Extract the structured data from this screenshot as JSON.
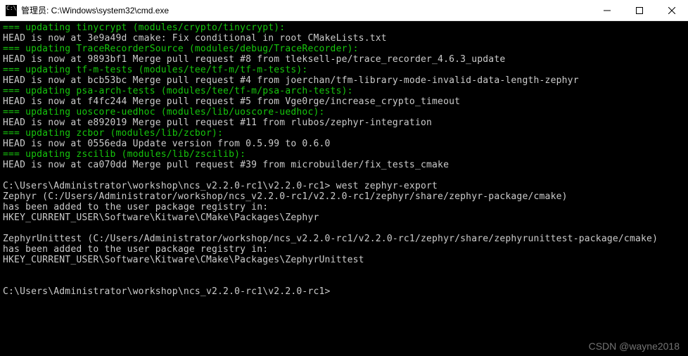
{
  "window": {
    "title": "管理员: C:\\Windows\\system32\\cmd.exe"
  },
  "lines": [
    {
      "spans": [
        {
          "c": "g",
          "t": "=== updating tinycrypt (modules/crypto/tinycrypt):"
        }
      ]
    },
    {
      "spans": [
        {
          "c": "w",
          "t": "HEAD is now at 3e9a49d cmake: Fix conditional in root CMakeLists.txt"
        }
      ]
    },
    {
      "spans": [
        {
          "c": "g",
          "t": "=== updating TraceRecorderSource (modules/debug/TraceRecorder):"
        }
      ]
    },
    {
      "spans": [
        {
          "c": "w",
          "t": "HEAD is now at 9893bf1 Merge pull request #8 from tleksell-pe/trace_recorder_4.6.3_update"
        }
      ]
    },
    {
      "spans": [
        {
          "c": "g",
          "t": "=== updating tf-m-tests (modules/tee/tf-m/tf-m-tests):"
        }
      ]
    },
    {
      "spans": [
        {
          "c": "w",
          "t": "HEAD is now at bcb53bc Merge pull request #4 from joerchan/tfm-library-mode-invalid-data-length-zephyr"
        }
      ]
    },
    {
      "spans": [
        {
          "c": "g",
          "t": "=== updating psa-arch-tests (modules/tee/tf-m/psa-arch-tests):"
        }
      ]
    },
    {
      "spans": [
        {
          "c": "w",
          "t": "HEAD is now at f4fc244 Merge pull request #5 from Vge0rge/increase_crypto_timeout"
        }
      ]
    },
    {
      "spans": [
        {
          "c": "g",
          "t": "=== updating uoscore-uedhoc (modules/lib/uoscore-uedhoc):"
        }
      ]
    },
    {
      "spans": [
        {
          "c": "w",
          "t": "HEAD is now at e892019 Merge pull request #11 from rlubos/zephyr-integration"
        }
      ]
    },
    {
      "spans": [
        {
          "c": "g",
          "t": "=== updating zcbor (modules/lib/zcbor):"
        }
      ]
    },
    {
      "spans": [
        {
          "c": "w",
          "t": "HEAD is now at 0556eda Update version from 0.5.99 to 0.6.0"
        }
      ]
    },
    {
      "spans": [
        {
          "c": "g",
          "t": "=== updating zscilib (modules/lib/zscilib):"
        }
      ]
    },
    {
      "spans": [
        {
          "c": "w",
          "t": "HEAD is now at ca070dd Merge pull request #39 from microbuilder/fix_tests_cmake"
        }
      ]
    },
    {
      "spans": [
        {
          "c": "w",
          "t": ""
        }
      ]
    },
    {
      "spans": [
        {
          "c": "w",
          "t": "C:\\Users\\Administrator\\workshop\\ncs_v2.2.0-rc1\\v2.2.0-rc1> west zephyr-export"
        }
      ]
    },
    {
      "spans": [
        {
          "c": "w",
          "t": "Zephyr (C:/Users/Administrator/workshop/ncs_v2.2.0-rc1/v2.2.0-rc1/zephyr/share/zephyr-package/cmake)"
        }
      ]
    },
    {
      "spans": [
        {
          "c": "w",
          "t": "has been added to the user package registry in:"
        }
      ]
    },
    {
      "spans": [
        {
          "c": "w",
          "t": "HKEY_CURRENT_USER\\Software\\Kitware\\CMake\\Packages\\Zephyr"
        }
      ]
    },
    {
      "spans": [
        {
          "c": "w",
          "t": ""
        }
      ]
    },
    {
      "spans": [
        {
          "c": "w",
          "t": "ZephyrUnittest (C:/Users/Administrator/workshop/ncs_v2.2.0-rc1/v2.2.0-rc1/zephyr/share/zephyrunittest-package/cmake)"
        }
      ]
    },
    {
      "spans": [
        {
          "c": "w",
          "t": "has been added to the user package registry in:"
        }
      ]
    },
    {
      "spans": [
        {
          "c": "w",
          "t": "HKEY_CURRENT_USER\\Software\\Kitware\\CMake\\Packages\\ZephyrUnittest"
        }
      ]
    },
    {
      "spans": [
        {
          "c": "w",
          "t": ""
        }
      ]
    },
    {
      "spans": [
        {
          "c": "w",
          "t": ""
        }
      ]
    },
    {
      "spans": [
        {
          "c": "w",
          "t": "C:\\Users\\Administrator\\workshop\\ncs_v2.2.0-rc1\\v2.2.0-rc1>"
        }
      ]
    }
  ],
  "watermark": "CSDN @wayne2018"
}
